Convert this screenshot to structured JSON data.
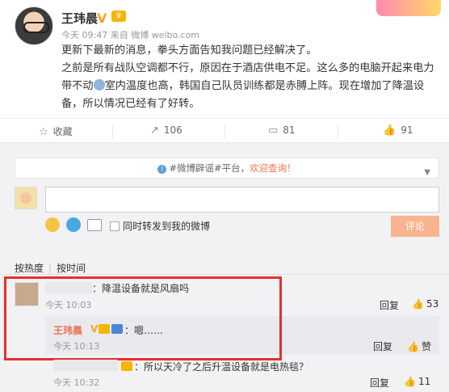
{
  "post": {
    "user_name": "王玮晨",
    "meta": "今天 09:47 来自 微博 weibo.com",
    "paragraph1": "更新下最新的消息，拳头方面告知我问题已经解决了。",
    "paragraph2a": "之前是所有战队空调都不行，原因在于酒店供电不足。这么多的电脑开起来电力带不动",
    "paragraph2b": "室内温度也高，韩国自己队员训练都是赤膊上阵。现在增加了降温设备，所以情况已经有了好转。"
  },
  "actions": {
    "favorite": "收藏",
    "forward_count": "106",
    "comment_count": "81",
    "like_count": "91"
  },
  "notice": {
    "prefix": "#微博辟谣#平台，",
    "link": "欢迎查询！"
  },
  "composer": {
    "forward_label": "同时转发到我的微博",
    "submit_label": "评论"
  },
  "sort": {
    "hot": "按热度",
    "time": "按时间"
  },
  "comments": [
    {
      "text": "：降温设备就是风扇吗",
      "time": "今天 10:03",
      "reply_label": "回复",
      "likes": "53"
    },
    {
      "text": "：所以天冷了之后升温设备就是电热毯？",
      "time": "今天 10:32",
      "reply_label": "回复",
      "likes": "11"
    }
  ],
  "reply": {
    "name": "王玮晨",
    "text": "：嗯……",
    "time": "今天 10:13",
    "reply_label": "回复",
    "like_label": "赞"
  },
  "colors": {
    "accent": "#eb7350",
    "highlight": "#e53030",
    "submit": "#f7b48e"
  },
  "icons": [
    "star-icon",
    "forward-icon",
    "comment-icon",
    "thumb-up-icon",
    "info-icon",
    "chevron-down-icon",
    "emoji-icon",
    "gif-icon",
    "image-icon",
    "v-badge-icon",
    "vip-badge-icon"
  ]
}
